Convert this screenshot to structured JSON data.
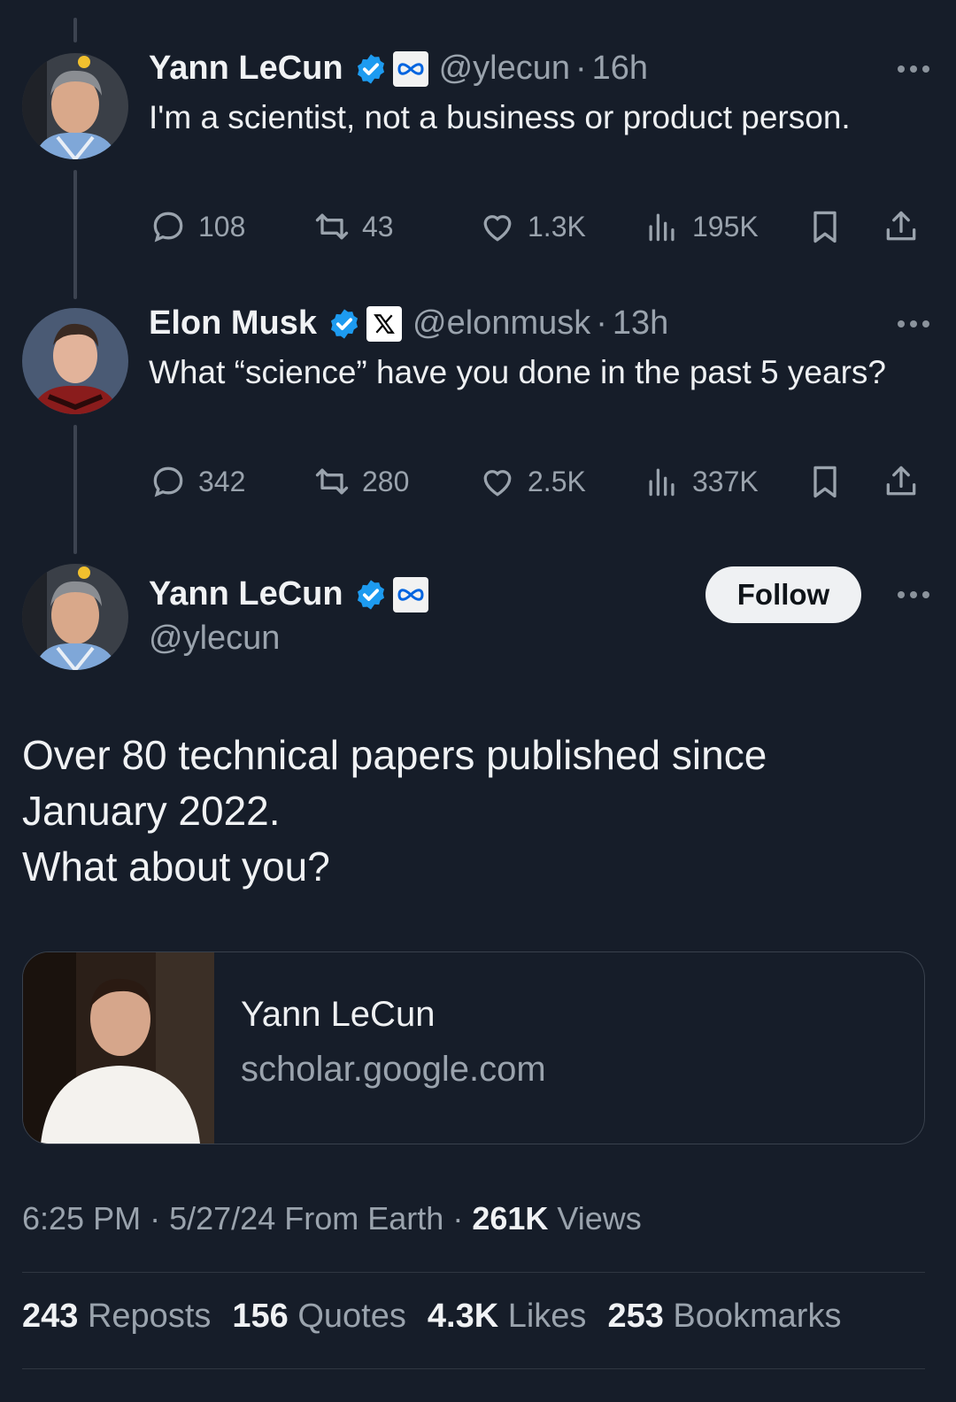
{
  "thread": [
    {
      "name": "Yann LeCun",
      "handle": "@ylecun",
      "time": "16h",
      "text": "I'm a scientist, not a business or product person.",
      "replies": "108",
      "reposts": "43",
      "likes": "1.3K",
      "views": "195K",
      "affiliation_icon": "meta-logo-icon"
    },
    {
      "name": "Elon Musk",
      "handle": "@elonmusk",
      "time": "13h",
      "text": "What “science” have you done in the past 5 years?",
      "replies": "342",
      "reposts": "280",
      "likes": "2.5K",
      "views": "337K",
      "affiliation_icon": "x-logo-icon"
    }
  ],
  "main_tweet": {
    "name": "Yann LeCun",
    "handle": "@ylecun",
    "follow_label": "Follow",
    "text": "Over 80 technical papers published since\nJanuary 2022.\nWhat about you?",
    "card": {
      "title": "Yann LeCun",
      "domain": "scholar.google.com"
    },
    "meta": {
      "time": "6:25 PM",
      "date": "5/27/24",
      "location": "From Earth",
      "views_count": "261K",
      "views_label": "Views",
      "sep": "·"
    },
    "stats": {
      "reposts_count": "243",
      "reposts_label": "Reposts",
      "quotes_count": "156",
      "quotes_label": "Quotes",
      "likes_count": "4.3K",
      "likes_label": "Likes",
      "bookmarks_count": "253",
      "bookmarks_label": "Bookmarks"
    }
  },
  "colors": {
    "background": "#161d29",
    "verified": "#1d9bf0",
    "muted": "#9aa3ad"
  }
}
